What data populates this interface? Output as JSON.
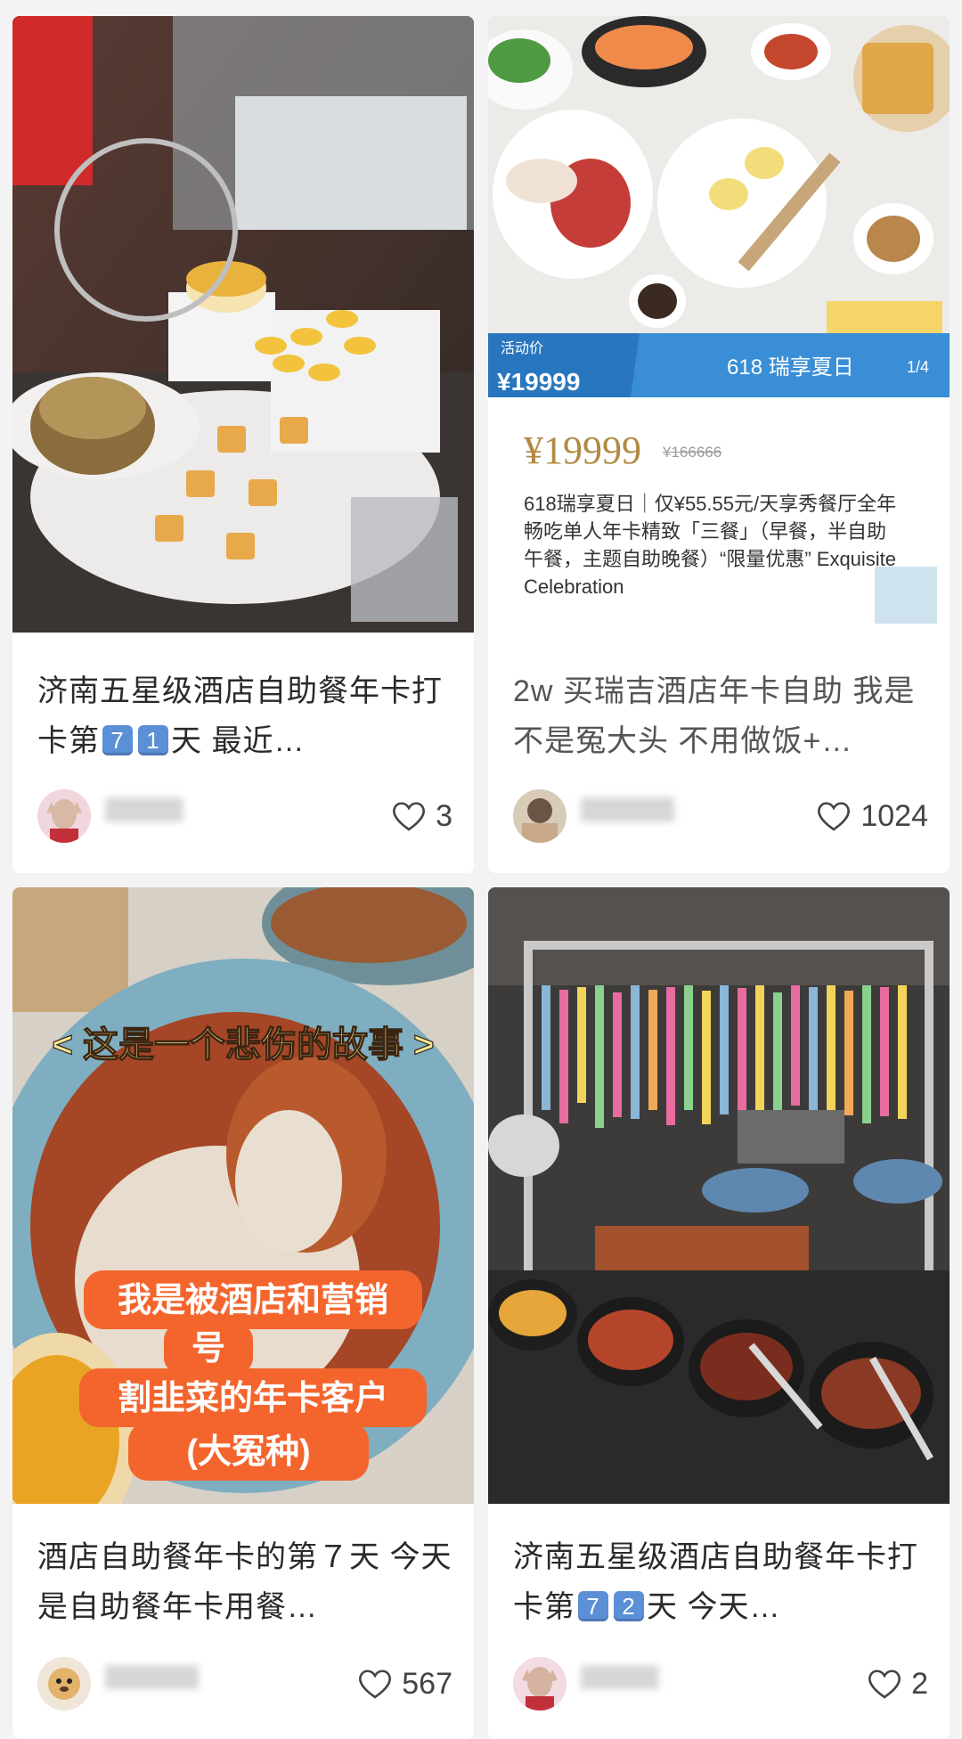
{
  "posts": [
    {
      "title": "济南五星级酒店自助餐年卡打卡第",
      "title_num_1": "7",
      "title_num_2": "1",
      "title_suffix": "天 最近…",
      "likes": "3"
    },
    {
      "title": "2w 买瑞吉酒店年卡自助 我是不是冤大头 不用做饭+…",
      "likes": "1024",
      "banner": {
        "activity_label": "活动价",
        "banner_price": "¥19999",
        "banner_text": "618 瑞享夏日",
        "page_indicator": "1/4",
        "price": "¥19999",
        "original_price": "¥166666",
        "description": "618瑞享夏日｜仅¥55.55元/天享秀餐厅全年畅吃单人年卡精致「三餐」（早餐，半自助午餐，主题自助晚餐）“限量优惠” Exquisite Celebration"
      }
    },
    {
      "title": "酒店自助餐年卡的第７天 今天是自助餐年卡用餐…",
      "likes": "567",
      "overlay_top": "< 这是一个悲伤的故事 >",
      "overlay_lines": [
        "我是被酒店和营销",
        "号",
        "割韭菜的年卡客户",
        "(大冤种)"
      ]
    },
    {
      "title": "济南五星级酒店自助餐年卡打卡第",
      "title_num_1": "7",
      "title_num_2": "2",
      "title_suffix": "天 今天…",
      "likes": "2"
    }
  ]
}
